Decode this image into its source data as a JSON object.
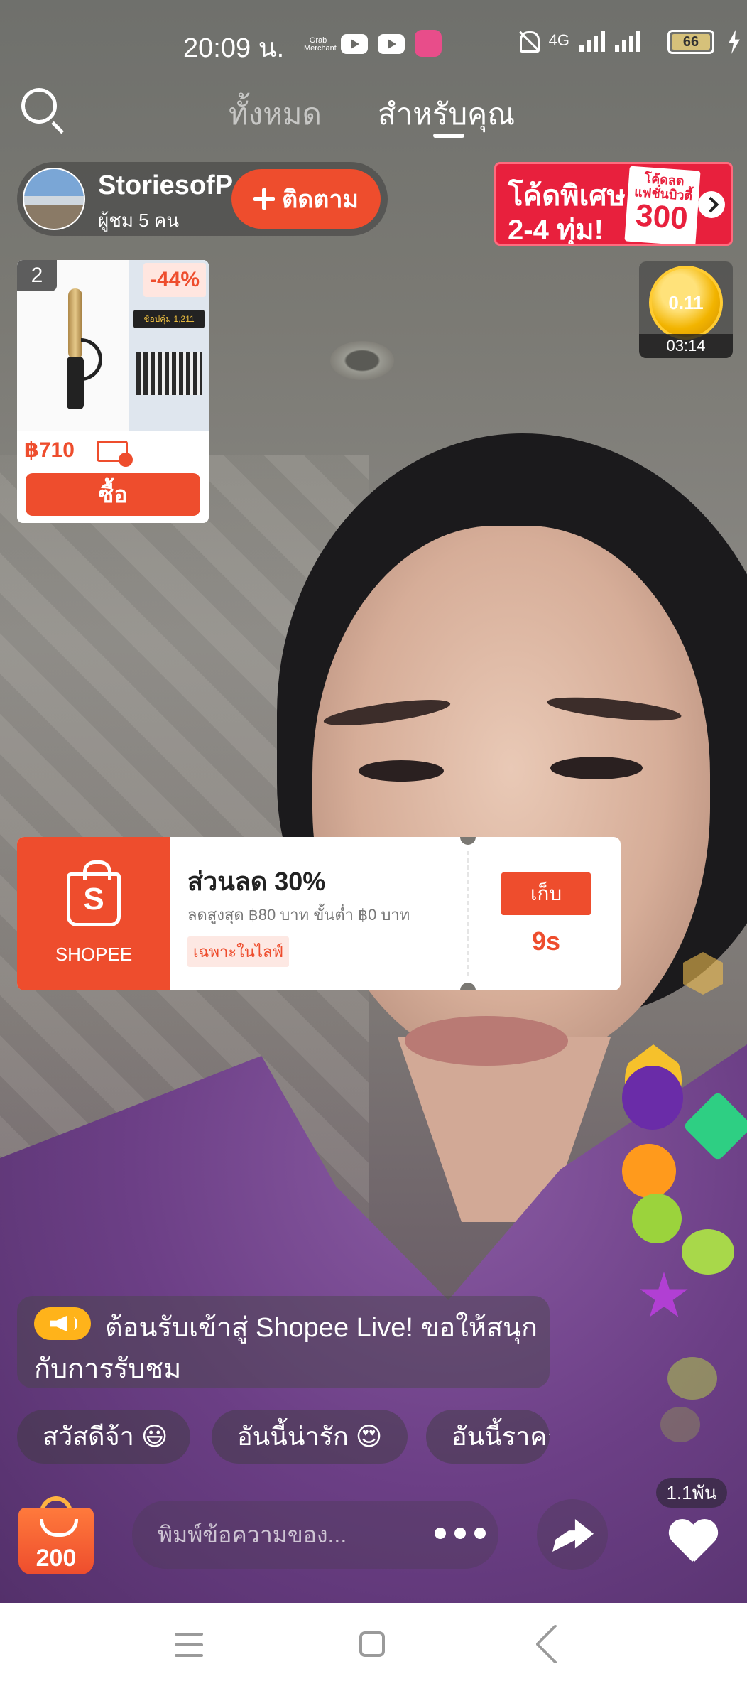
{
  "status_bar": {
    "time": "20:09 น.",
    "grab_label": "Grab Merchant",
    "network": "4G",
    "battery": "66"
  },
  "top_nav": {
    "tab_all": "ทั้งหมด",
    "tab_for_you": "สำหรับคุณ"
  },
  "host": {
    "name": "StoriesofP",
    "viewers": "ผู้ชม 5 คน",
    "follow_label": "ติดตาม"
  },
  "promo_banner": {
    "line1": "โค้ดพิเศษ",
    "line2": "2-4 ทุ่ม!",
    "coupon_label": "โค้ดลด แฟชั่นบิวตี้",
    "coupon_value": "300"
  },
  "product_card": {
    "rank": "2",
    "discount": "-44%",
    "side_label": "ช้อปคุ้ม 1,211",
    "price": "฿710",
    "buy_label": "ซื้อ"
  },
  "coin_timer": {
    "coins": "0.11",
    "time": "03:14"
  },
  "voucher": {
    "brand": "SHOPEE",
    "brand_letter": "S",
    "title": "ส่วนลด 30%",
    "description": "ลดสูงสุด ฿80 บาท ขั้นต่ำ ฿0 บาท",
    "tag": "เฉพาะในไลฟ์",
    "claim_label": "เก็บ",
    "countdown": "9s"
  },
  "welcome_message": "ต้อนรับเข้าสู่ Shopee Live! ขอให้สนุกกับการรับชม",
  "quick_replies": [
    "สวัสดีจ้า 😃",
    "อันนี้น่ารัก 😍",
    "อันนี้ราคา"
  ],
  "bottom_bar": {
    "cart_count": "200",
    "chat_placeholder": "พิมพ์ข้อความของ...",
    "like_count": "1.1พัน"
  },
  "icons": {
    "search": "search-icon",
    "plus": "plus-icon",
    "chevron": "chevron-right-icon",
    "megaphone": "megaphone-icon",
    "bag": "shopping-bag-icon",
    "more": "more-dots-icon",
    "share": "share-icon",
    "heart": "heart-icon"
  },
  "colors": {
    "accent": "#ee4d2d",
    "promo_red": "#e8203d",
    "coin_gold": "#f2b400"
  }
}
